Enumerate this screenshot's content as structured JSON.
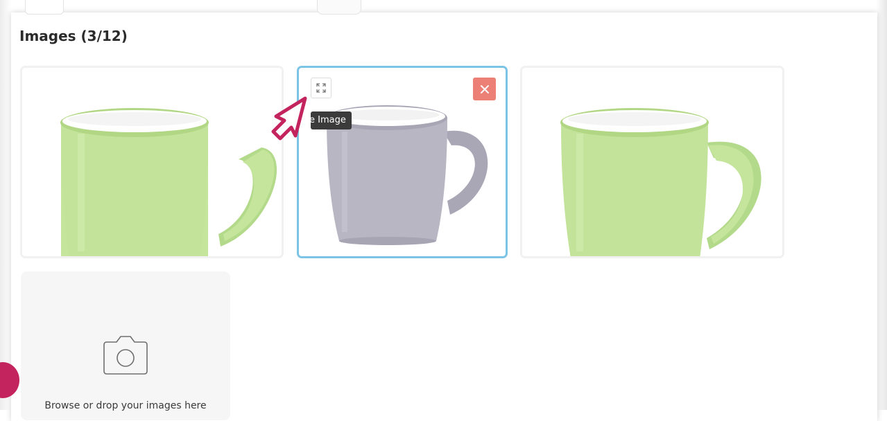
{
  "section": {
    "title": "Images (3/12)"
  },
  "images": [
    {
      "alt": "green mug",
      "color": "#c4e59b",
      "selected": false
    },
    {
      "alt": "grey mug",
      "color": "#b9b6c4",
      "selected": true
    },
    {
      "alt": "green mug",
      "color": "#c4e59b",
      "selected": false
    }
  ],
  "card_actions": {
    "expand_icon": "expand-icon",
    "delete_icon": "close-icon",
    "tooltip_text": "e Image"
  },
  "upload": {
    "icon": "camera-icon",
    "text": "Browse or drop your images here"
  },
  "colors": {
    "accent_selected": "#7cc4e6",
    "delete": "#ec8076",
    "pointer": "#c3245e"
  }
}
